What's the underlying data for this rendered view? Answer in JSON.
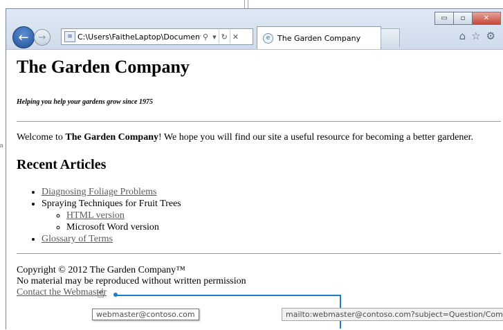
{
  "browser": {
    "address": "C:\\Users\\FaitheLaptop\\Documents\\",
    "tab_title": "The Garden Company",
    "caption": {
      "minimize": "▭",
      "maximize": "▫",
      "close": "✕"
    }
  },
  "page": {
    "title": "The Garden Company",
    "tagline": "Helping you help your gardens grow since 1975",
    "welcome_prefix": "Welcome to ",
    "welcome_bold": "The Garden Company",
    "welcome_suffix": "! We hope you will find our site a useful resource for becoming a better gardener.",
    "section_heading": "Recent Articles",
    "articles": {
      "item1": "Diagnosing Foliage Problems",
      "item2": "Spraying Techniques for Fruit Trees",
      "item2_sub1": "HTML version",
      "item2_sub2": "Microsoft Word version",
      "item3": "Glossary of Terms"
    },
    "footer": {
      "copyright": "Copyright © 2012 The Garden Company™",
      "notice": "No material may be reproduced without written permission",
      "contact_link": "Contact the Webmaster"
    }
  },
  "overlay": {
    "tooltip": "webmaster@contoso.com",
    "status_url": "mailto:webmaster@contoso.com?subject=Question/Comment"
  }
}
